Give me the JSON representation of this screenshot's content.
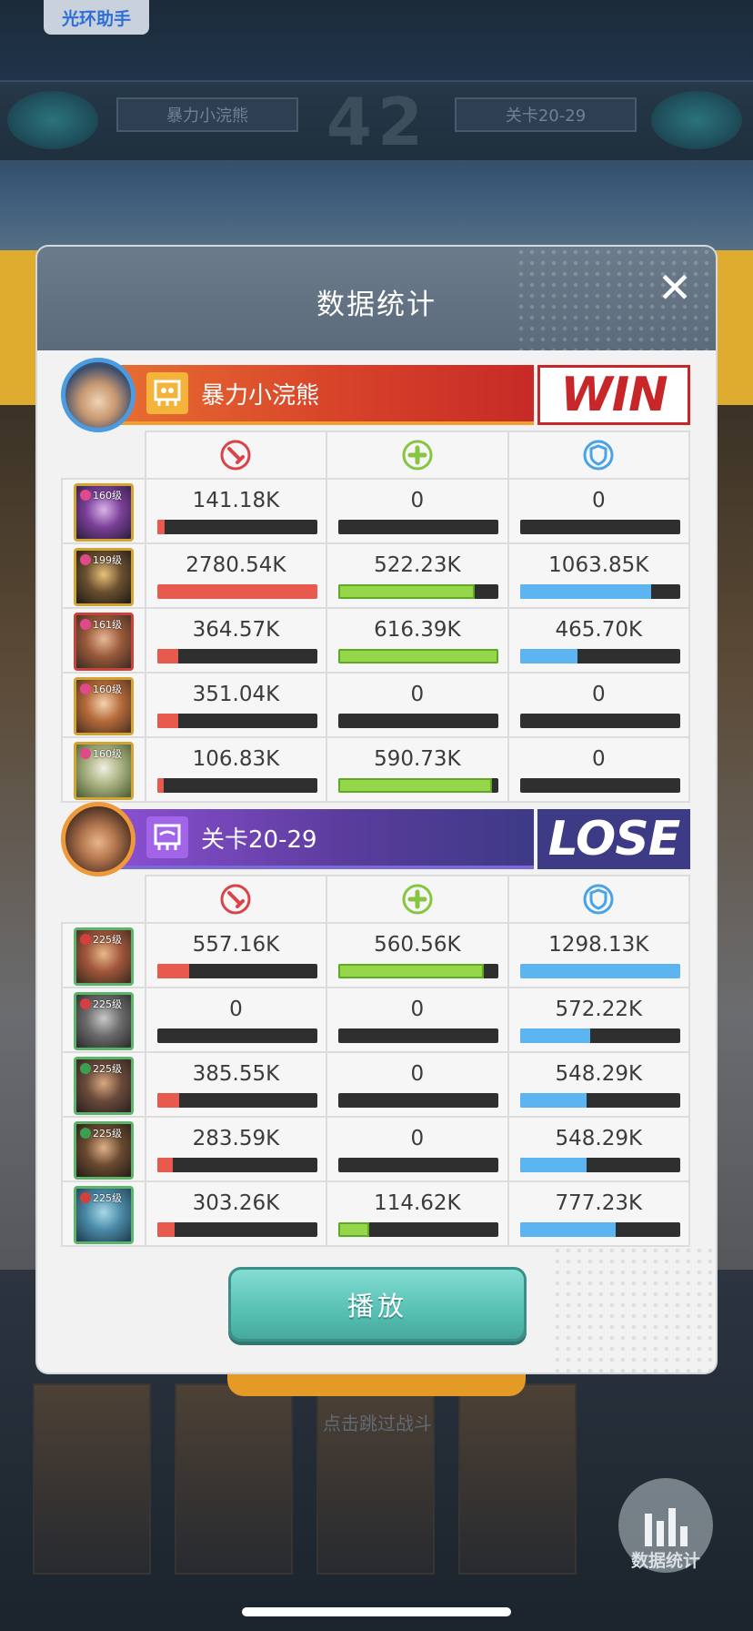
{
  "background": {
    "helper_label": "光环助手",
    "score": "42",
    "left_name": "暴力小浣熊",
    "right_name": "关卡20-29",
    "tip": "点击跳过战斗",
    "stat_button_label": "数据统计"
  },
  "dialog": {
    "title": "数据统计",
    "close_icon": "close-icon",
    "play_label": "播放"
  },
  "columns": [
    {
      "name": "damage",
      "icon": "sword-icon",
      "color": "#d9434a"
    },
    {
      "name": "healing",
      "icon": "plus-icon",
      "color": "#86c540"
    },
    {
      "name": "defense",
      "icon": "shield-icon",
      "color": "#4aa3e6"
    }
  ],
  "colors": {
    "win_banner": "#d8452a",
    "lose_banner": "#3d3a86",
    "damage_bar": "#e85a4d",
    "heal_bar": "#96d64a",
    "shield_bar": "#5cb5f0",
    "play_button": "#57c0b4"
  },
  "teams": [
    {
      "name": "暴力小浣熊",
      "result": "WIN",
      "heroes": [
        {
          "level": "160级",
          "damage": "141.18K",
          "heal": "0",
          "shield": "0",
          "damage_frac": 0.05,
          "heal_frac": 0,
          "shield_frac": 0
        },
        {
          "level": "199级",
          "damage": "2780.54K",
          "heal": "522.23K",
          "shield": "1063.85K",
          "damage_frac": 1.0,
          "heal_frac": 0.85,
          "shield_frac": 0.82
        },
        {
          "level": "161级",
          "damage": "364.57K",
          "heal": "616.39K",
          "shield": "465.70K",
          "damage_frac": 0.13,
          "heal_frac": 1.0,
          "shield_frac": 0.36
        },
        {
          "level": "160级",
          "damage": "351.04K",
          "heal": "0",
          "shield": "0",
          "damage_frac": 0.13,
          "heal_frac": 0,
          "shield_frac": 0
        },
        {
          "level": "160级",
          "damage": "106.83K",
          "heal": "590.73K",
          "shield": "0",
          "damage_frac": 0.04,
          "heal_frac": 0.96,
          "shield_frac": 0
        }
      ]
    },
    {
      "name": "关卡20-29",
      "result": "LOSE",
      "heroes": [
        {
          "level": "225级",
          "damage": "557.16K",
          "heal": "560.56K",
          "shield": "1298.13K",
          "damage_frac": 0.2,
          "heal_frac": 0.91,
          "shield_frac": 1.0
        },
        {
          "level": "225级",
          "damage": "0",
          "heal": "0",
          "shield": "572.22K",
          "damage_frac": 0,
          "heal_frac": 0,
          "shield_frac": 0.44
        },
        {
          "level": "225级",
          "damage": "385.55K",
          "heal": "0",
          "shield": "548.29K",
          "damage_frac": 0.14,
          "heal_frac": 0,
          "shield_frac": 0.42
        },
        {
          "level": "225级",
          "damage": "283.59K",
          "heal": "0",
          "shield": "548.29K",
          "damage_frac": 0.1,
          "heal_frac": 0,
          "shield_frac": 0.42
        },
        {
          "level": "225级",
          "damage": "303.26K",
          "heal": "114.62K",
          "shield": "777.23K",
          "damage_frac": 0.11,
          "heal_frac": 0.19,
          "shield_frac": 0.6
        }
      ]
    }
  ]
}
